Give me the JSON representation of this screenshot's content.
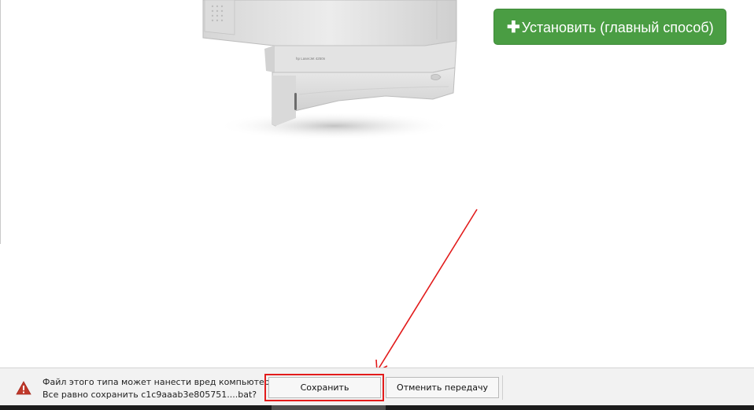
{
  "install_button": {
    "label": "Установить (главный способ)",
    "icon": "plus-icon",
    "color": "#4a9d43"
  },
  "printer_image": {
    "icon": "printer-image",
    "brand_text": "hp LaserJet 4250n"
  },
  "download_bar": {
    "warning_icon": "warning-icon",
    "warning_line1": "Файл этого типа может нанести вред компьютеру.",
    "warning_line2": "Все равно сохранить c1c9aaab3e805751....bat?",
    "save_label": "Сохранить",
    "cancel_label": "Отменить передачу",
    "highlight_color": "#e21b1b"
  },
  "annotation": {
    "arrow_color": "#e21b1b"
  }
}
